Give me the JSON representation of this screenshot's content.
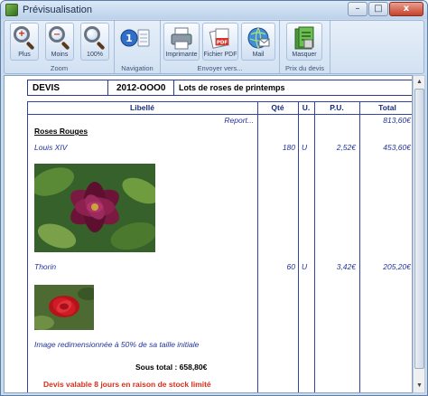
{
  "window": {
    "title": "Prévisualisation",
    "minimize": "–",
    "maximize": "□",
    "close": "x"
  },
  "toolbar": {
    "zoom_group": "Zoom",
    "zoom_in": "Plus",
    "zoom_out": "Moins",
    "zoom_100": "100%",
    "navigation_group": "Navigation",
    "send_group": "Envoyer vers...",
    "printer": "Imprimante",
    "pdf": "Fichier PDF",
    "mail": "Mail",
    "price_group": "Prix du devis",
    "hide": "Masquer"
  },
  "document": {
    "type": "DEVIS",
    "number": "2012-OOO0",
    "subject": "Lots de roses de printemps",
    "columns": {
      "label": "Libellé",
      "qty": "Qté",
      "unit": "U.",
      "unit_price": "P.U.",
      "total": "Total"
    },
    "report_label": "Report...",
    "report_total": "813,60€",
    "section_title": "Roses Rouges",
    "items": [
      {
        "label": "Louis XIV",
        "qty": "180",
        "unit": "U",
        "unit_price": "2,52€",
        "total": "453,60€"
      },
      {
        "label": "Thorin",
        "qty": "60",
        "unit": "U",
        "unit_price": "3,42€",
        "total": "205,20€"
      }
    ],
    "image_note": "Image redimensionnée à 50% de sa taille initiale",
    "subtotal": "Sous total : 658,80€",
    "warning": "Devis valable 8 jours en raison de stock limité"
  },
  "colors": {
    "accent": "#2b3a8a",
    "warning": "#d2301e",
    "window_frame": "#c9dcef"
  }
}
